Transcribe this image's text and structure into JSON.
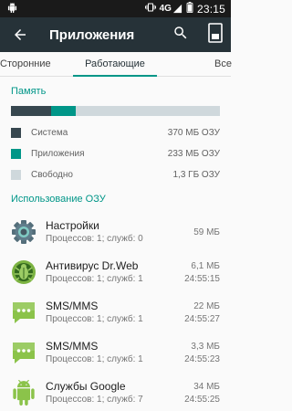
{
  "status_bar": {
    "network": "4G",
    "time": "23:15",
    "icons": [
      "android-notification-icon",
      "vibrate-icon",
      "signal-icon",
      "battery-icon"
    ]
  },
  "toolbar": {
    "title": "Приложения",
    "icons": [
      "back-arrow-icon",
      "search-icon",
      "memory-card-icon"
    ]
  },
  "tabs": [
    {
      "label": "Сторонние",
      "selected": false
    },
    {
      "label": "Работающие",
      "selected": true
    },
    {
      "label": "Все",
      "selected": false
    }
  ],
  "memory": {
    "title": "Память",
    "usage_fractions": {
      "system": 0.19,
      "apps": 0.12,
      "free": 0.69
    },
    "legend": [
      {
        "label": "Система",
        "value": "370 МБ ОЗУ",
        "color": "#37474f"
      },
      {
        "label": "Приложения",
        "value": "233 МБ ОЗУ",
        "color": "#009688"
      },
      {
        "label": "Свободно",
        "value": "1,3 ГБ ОЗУ",
        "color": "#cfd8dc"
      }
    ]
  },
  "ram_usage": {
    "title": "Использование ОЗУ",
    "apps": [
      {
        "name": "Настройки",
        "details": "Процессов: 1; служб: 0",
        "size": "59 МБ",
        "duration": "",
        "icon": "settings-gear-icon"
      },
      {
        "name": "Антивирус Dr.Web",
        "details": "Процессов: 1; служб: 1",
        "size": "6,1 МБ",
        "duration": "24:55:15",
        "icon": "drweb-antivirus-icon"
      },
      {
        "name": "SMS/MMS",
        "details": "Процессов: 1; служб: 1",
        "size": "22 МБ",
        "duration": "24:55:27",
        "icon": "messaging-icon"
      },
      {
        "name": "SMS/MMS",
        "details": "Процессов: 1; служб: 1",
        "size": "3,3 МБ",
        "duration": "24:55:23",
        "icon": "messaging-icon"
      },
      {
        "name": "Службы Google",
        "details": "Процессов: 1; служб: 7",
        "size": "34 МБ",
        "duration": "24:55:25",
        "icon": "android-robot-icon"
      }
    ]
  },
  "colors": {
    "accent": "#009688",
    "toolbar": "#263238",
    "status_bar": "#1a1a1a"
  }
}
